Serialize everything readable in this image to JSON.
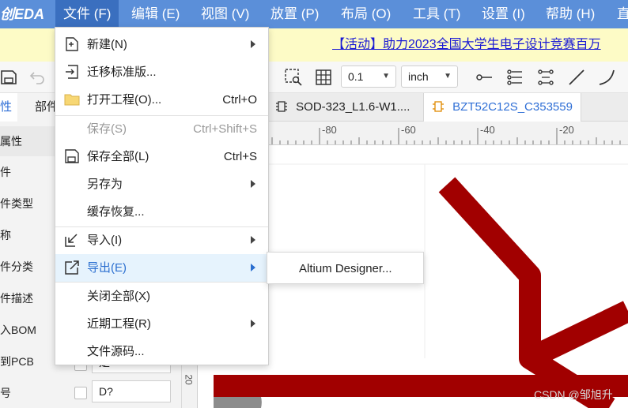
{
  "menubar": {
    "logo": "创EDA",
    "items": [
      "文件 (F)",
      "编辑 (E)",
      "视图 (V)",
      "放置 (P)",
      "布局 (O)",
      "工具 (T)",
      "设置 (I)",
      "帮助 (H)",
      "直"
    ],
    "active_index": 0
  },
  "announcement": {
    "text": "【活动】助力2023全国大学生电子设计竞赛百万"
  },
  "toolbar": {
    "grid_value": "0.1",
    "unit_value": "inch"
  },
  "tabs": {
    "items": [
      "SOD-323_L1.6-W1....",
      "BZT52C12S_C353559"
    ],
    "active_index": 1
  },
  "left_panel": {
    "tabs": [
      "性",
      "部件"
    ],
    "header": "属性",
    "rows": [
      "件",
      "件类型",
      "称",
      "件分类",
      "件描述",
      "入BOM",
      "到PCB",
      "号"
    ],
    "input_values": [
      "是",
      "D?"
    ]
  },
  "ruler": {
    "labels": [
      "-80",
      "-60",
      "-40",
      "-20"
    ],
    "vertical_label": "20"
  },
  "file_menu": {
    "items": [
      {
        "label": "新建(N)",
        "shortcut": "",
        "submenu": true,
        "disabled": false,
        "icon": "new-file-icon"
      },
      {
        "label": "迁移标准版...",
        "shortcut": "",
        "submenu": false,
        "disabled": false,
        "icon": "migrate-icon"
      },
      {
        "label": "打开工程(O)...",
        "shortcut": "Ctrl+O",
        "submenu": false,
        "disabled": false,
        "icon": "folder-icon"
      },
      {
        "label": "保存(S)",
        "shortcut": "Ctrl+Shift+S",
        "submenu": false,
        "disabled": true,
        "icon": ""
      },
      {
        "label": "保存全部(L)",
        "shortcut": "Ctrl+S",
        "submenu": false,
        "disabled": false,
        "icon": "save-icon"
      },
      {
        "label": "另存为",
        "shortcut": "",
        "submenu": true,
        "disabled": false,
        "icon": ""
      },
      {
        "label": "缓存恢复...",
        "shortcut": "",
        "submenu": false,
        "disabled": false,
        "icon": ""
      },
      {
        "label": "导入(I)",
        "shortcut": "",
        "submenu": true,
        "disabled": false,
        "icon": "import-icon"
      },
      {
        "label": "导出(E)",
        "shortcut": "",
        "submenu": true,
        "disabled": false,
        "icon": "export-icon"
      },
      {
        "label": "关闭全部(X)",
        "shortcut": "",
        "submenu": false,
        "disabled": false,
        "icon": ""
      },
      {
        "label": "近期工程(R)",
        "shortcut": "",
        "submenu": true,
        "disabled": false,
        "icon": ""
      },
      {
        "label": "文件源码...",
        "shortcut": "",
        "submenu": false,
        "disabled": false,
        "icon": ""
      }
    ],
    "hover_index": 8
  },
  "export_submenu": {
    "items": [
      "Altium Designer..."
    ]
  },
  "watermark": "CSDN @邹旭升",
  "colors": {
    "menubar_bg": "#5b8fd9",
    "accent": "#2f6fd6",
    "trace": "#a10000",
    "hover_bg": "#e6f3fd",
    "announcement_bg": "#fdfbc6"
  }
}
